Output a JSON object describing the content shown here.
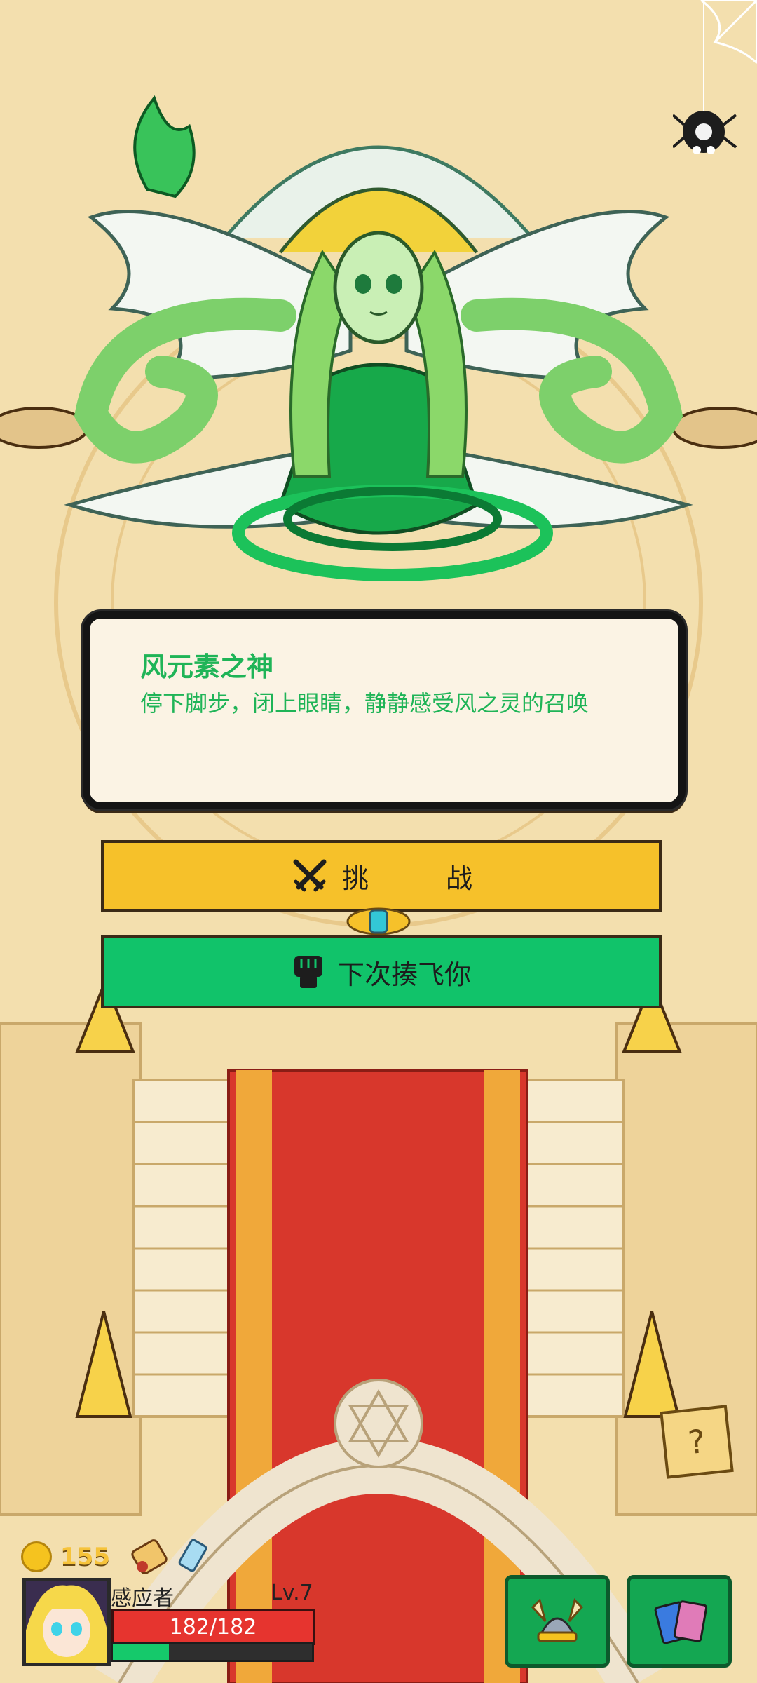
{
  "boss": {
    "name": "风元素之神",
    "description": "停下脚步，闭上眼睛，静静感受风之灵的召唤"
  },
  "buttons": {
    "challenge_left": "挑",
    "challenge_right": "战",
    "next_time": "下次揍飞你"
  },
  "currency": {
    "coins": "155"
  },
  "player": {
    "name": "感应者",
    "level": "Lv.7",
    "hp": "182/182",
    "exp_fraction": 0.28
  },
  "colors": {
    "accent_green": "#1fb457",
    "challenge_yellow": "#f6c12a",
    "next_green": "#11c36a",
    "hp_red": "#e6342f"
  }
}
